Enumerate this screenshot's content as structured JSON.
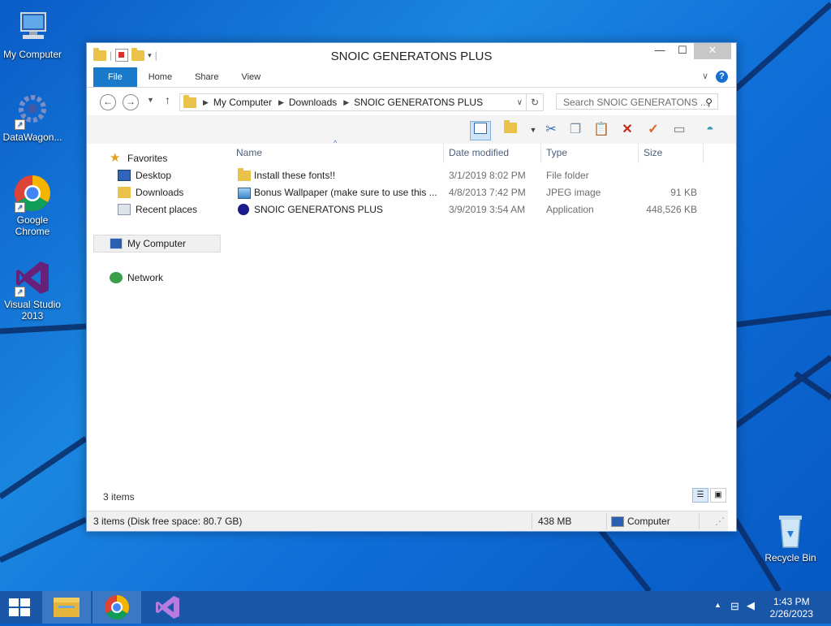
{
  "desktop": {
    "icons": [
      {
        "label": "My Computer"
      },
      {
        "label": "DataWagon..."
      },
      {
        "label": "Google Chrome"
      },
      {
        "label": "Visual Studio 2013"
      },
      {
        "label": "Recycle Bin"
      }
    ]
  },
  "window": {
    "title": "SNOIC GENERATONS PLUS",
    "controls": {
      "minimize": "—",
      "maximize": "☐",
      "close": "✕"
    },
    "ribbon": {
      "tabs": [
        {
          "label": "File"
        },
        {
          "label": "Home"
        },
        {
          "label": "Share"
        },
        {
          "label": "View"
        }
      ],
      "help": "?"
    },
    "address": {
      "path": [
        "My Computer",
        "Downloads",
        "SNOIC GENERATONS PLUS"
      ],
      "search_placeholder": "Search SNOIC GENERATONS ..."
    },
    "nav_pane": {
      "favorites_label": "Favorites",
      "favorites": [
        {
          "label": "Desktop"
        },
        {
          "label": "Downloads"
        },
        {
          "label": "Recent places"
        }
      ],
      "computer_label": "My Computer",
      "network_label": "Network"
    },
    "columns": {
      "name": "Name",
      "date": "Date modified",
      "type": "Type",
      "size": "Size"
    },
    "files": [
      {
        "name": "Install these fonts!!",
        "date": "3/1/2019 8:02 PM",
        "type": "File folder",
        "size": "",
        "icon": "folder-icon"
      },
      {
        "name": "Bonus Wallpaper (make sure to use this ...",
        "date": "4/8/2013 7:42 PM",
        "type": "JPEG image",
        "size": "91 KB",
        "icon": "image-icon"
      },
      {
        "name": "SNOIC GENERATONS PLUS",
        "date": "3/9/2019 3:54 AM",
        "type": "Application",
        "size": "448,526 KB",
        "icon": "app-icon"
      }
    ],
    "item_count": "3 items",
    "statusbar": {
      "summary": "3 items (Disk free space: 80.7 GB)",
      "size": "438 MB",
      "location": "Computer"
    }
  },
  "taskbar": {
    "time": "1:43 PM",
    "date": "2/26/2023"
  },
  "colors": {
    "accent": "#1979ca",
    "taskbar": "#1a56a8",
    "desktop": "#1a86e0"
  }
}
